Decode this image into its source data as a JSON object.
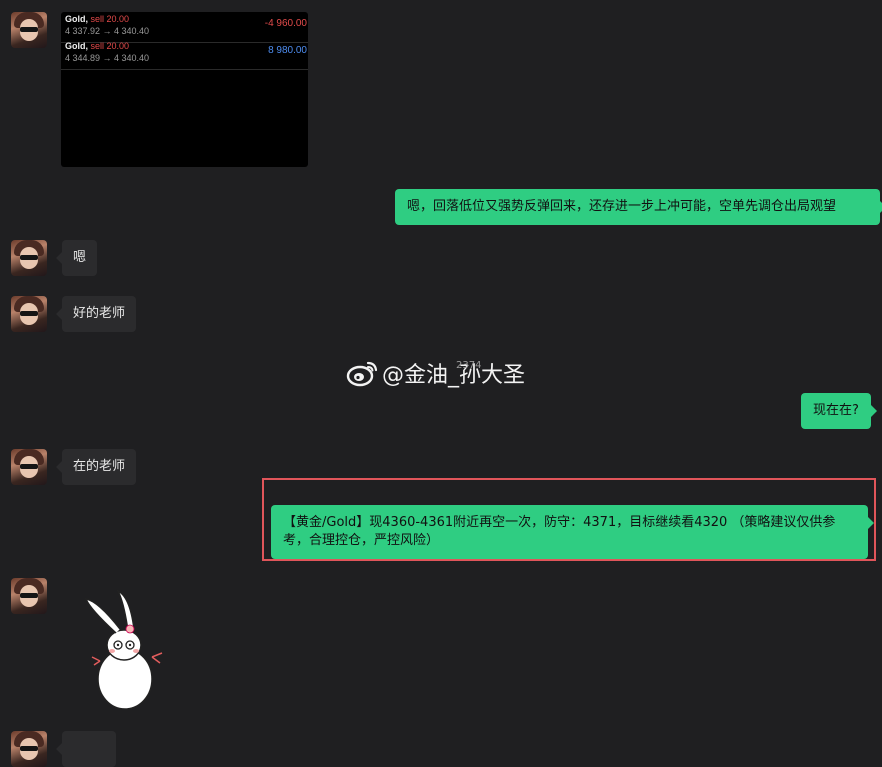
{
  "trade_card": {
    "rows": [
      {
        "symbol": "Gold,",
        "side": "sell 20.00",
        "price": "4 337.92 → 4 340.40",
        "pnl": "-4 960.00",
        "pnl_sign": "neg"
      },
      {
        "symbol": "Gold,",
        "side": "sell 20.00",
        "price": "4 344.89 → 4 340.40",
        "pnl": "8 980.00",
        "pnl_sign": "pos"
      }
    ]
  },
  "messages": {
    "out1": "嗯，回落低位又强势反弹回来，还存进一步上冲可能，空单先调仓出局观望",
    "in1": "嗯",
    "in2": "好的老师",
    "out2": "现在在?",
    "in3": "在的老师",
    "out3": "【黄金/Gold】现4360-4361附近再空一次，防守：4371，目标继续看4320 （策略建议仅供参考，合理控仓，严控风险）"
  },
  "watermark": {
    "text": "@金油_孙大圣",
    "overlay": "2374",
    "icon": "weibo-icon"
  },
  "colors": {
    "background": "#1f1f21",
    "bubble_in": "#2b2b2d",
    "bubble_out": "#2fcd82",
    "highlight": "#e0555a",
    "loss": "#e24b4b",
    "profit": "#4e8df0"
  }
}
